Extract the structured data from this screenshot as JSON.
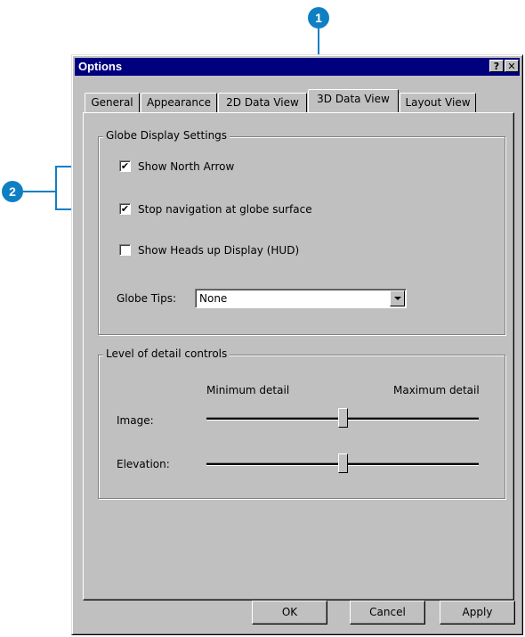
{
  "callouts": [
    "1",
    "2"
  ],
  "window": {
    "title": "Options",
    "help_button": "?",
    "close_button": "✕"
  },
  "tabs": [
    {
      "label": "General",
      "active": false
    },
    {
      "label": "Appearance",
      "active": false
    },
    {
      "label": "2D Data View",
      "active": false
    },
    {
      "label": "3D Data View",
      "active": true
    },
    {
      "label": "Layout View",
      "active": false
    }
  ],
  "globe": {
    "legend": "Globe Display Settings",
    "show_north_arrow": {
      "label": "Show North Arrow",
      "checked": true
    },
    "stop_navigation": {
      "label": "Stop navigation at globe surface",
      "checked": true
    },
    "show_hud": {
      "label": "Show Heads up Display (HUD)",
      "checked": false
    },
    "globe_tips_label": "Globe Tips:",
    "globe_tips_value": "None"
  },
  "lod": {
    "legend": "Level of detail controls",
    "min_label": "Minimum detail",
    "max_label": "Maximum detail",
    "image_label": "Image:",
    "image_level": 0.5,
    "elevation_label": "Elevation:",
    "elevation_level": 0.5
  },
  "buttons": {
    "ok": "OK",
    "cancel": "Cancel",
    "apply": "Apply"
  },
  "colors": {
    "callout": "#0f7fc3",
    "titlebar": "#00007f",
    "face": "#c0c0c0"
  }
}
